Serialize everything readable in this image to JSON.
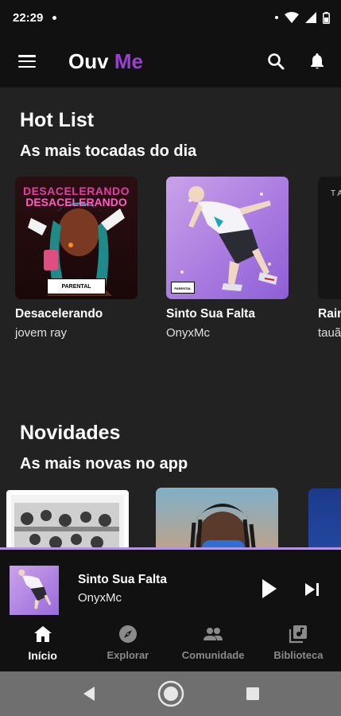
{
  "status_bar": {
    "time": "22:29"
  },
  "header": {
    "logo_primary": "Ouv",
    "logo_accent": "Me",
    "accent_color": "#9b3fd1",
    "icons": [
      "menu-icon",
      "search-icon",
      "bell-icon"
    ]
  },
  "hot_list": {
    "title": "Hot List",
    "subtitle": "As mais tocadas do dia",
    "items": [
      {
        "title": "Desacelerando",
        "artist": "jovem ray",
        "cover_text": "DESACELERANDO",
        "advisory": "PARENTAL ADVISORY"
      },
      {
        "title": "Sinto Sua Falta",
        "artist": "OnyxMc",
        "advisory": "PARENTAL ADVISORY"
      },
      {
        "title": "Rain",
        "artist": "tauã",
        "cover_text": "TA"
      }
    ]
  },
  "novidades": {
    "title": "Novidades",
    "subtitle": "As mais novas no app"
  },
  "mini_player": {
    "title": "Sinto Sua Falta",
    "artist": "OnyxMc",
    "accent_color": "#b594e0"
  },
  "bottom_nav": {
    "items": [
      {
        "label": "Início",
        "icon": "home-icon",
        "active": true
      },
      {
        "label": "Explorar",
        "icon": "compass-icon",
        "active": false
      },
      {
        "label": "Comunidade",
        "icon": "people-icon",
        "active": false
      },
      {
        "label": "Biblioteca",
        "icon": "library-icon",
        "active": false
      }
    ]
  }
}
